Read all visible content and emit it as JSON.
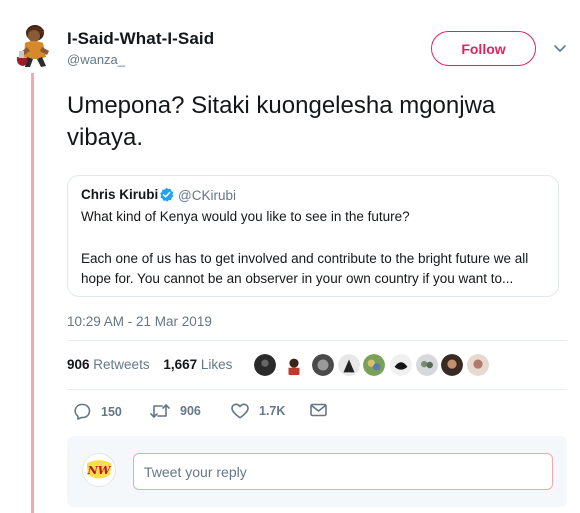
{
  "author": {
    "display_name": "I-Said-What-I-Said",
    "handle": "@wanza_",
    "avatar": "cartoon-avatar"
  },
  "follow_label": "Follow",
  "tweet_text": "Umepona? Sitaki kuongelesha mgonjwa vibaya.",
  "quoted_tweet": {
    "name": "Chris Kirubi",
    "verified": true,
    "handle": "@CKirubi",
    "line1": "What kind of Kenya would you like to see in the future?",
    "line2": "Each one of us has to get involved and contribute to the bright future we all hope for. You cannot be an observer in your own country if you want to..."
  },
  "timestamp": "10:29 AM - 21 Mar 2019",
  "stats": {
    "retweets_count": "906",
    "retweets_label": "Retweets",
    "likes_count": "1,667",
    "likes_label": "Likes"
  },
  "actions": {
    "reply_count": "150",
    "retweet_count": "906",
    "like_count": "1.7K"
  },
  "reply": {
    "placeholder": "Tweet your reply",
    "avatar_text": "NW"
  },
  "colors": {
    "accent": "#e0245e",
    "thread_line": "#f2a9aa",
    "secondary_text": "#657786"
  }
}
